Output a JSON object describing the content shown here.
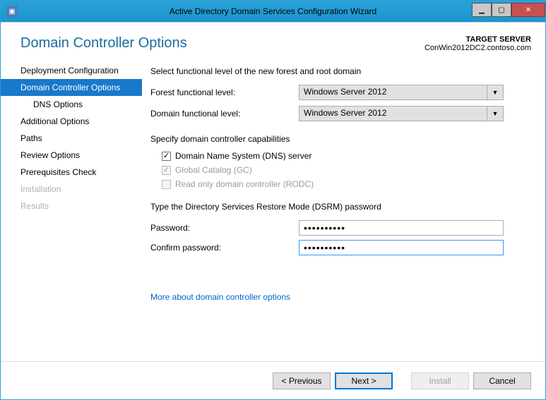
{
  "titlebar": {
    "title": "Active Directory Domain Services Configuration Wizard"
  },
  "header": {
    "page_title": "Domain Controller Options",
    "target_label": "TARGET SERVER",
    "target_value": "ConWin2012DC2.contoso.com"
  },
  "sidebar": {
    "items": [
      {
        "label": "Deployment Configuration",
        "active": false,
        "disabled": false,
        "sub": false
      },
      {
        "label": "Domain Controller Options",
        "active": true,
        "disabled": false,
        "sub": false
      },
      {
        "label": "DNS Options",
        "active": false,
        "disabled": false,
        "sub": true
      },
      {
        "label": "Additional Options",
        "active": false,
        "disabled": false,
        "sub": false
      },
      {
        "label": "Paths",
        "active": false,
        "disabled": false,
        "sub": false
      },
      {
        "label": "Review Options",
        "active": false,
        "disabled": false,
        "sub": false
      },
      {
        "label": "Prerequisites Check",
        "active": false,
        "disabled": false,
        "sub": false
      },
      {
        "label": "Installation",
        "active": false,
        "disabled": true,
        "sub": false
      },
      {
        "label": "Results",
        "active": false,
        "disabled": true,
        "sub": false
      }
    ]
  },
  "content": {
    "functional_intro": "Select functional level of the new forest and root domain",
    "ffl_label": "Forest functional level:",
    "ffl_value": "Windows Server 2012",
    "dfl_label": "Domain functional level:",
    "dfl_value": "Windows Server 2012",
    "caps_intro": "Specify domain controller capabilities",
    "chk_dns_label": "Domain Name System (DNS) server",
    "chk_dns_checked": true,
    "chk_gc_label": "Global Catalog (GC)",
    "chk_gc_checked": true,
    "chk_rodc_label": "Read only domain controller (RODC)",
    "chk_rodc_checked": false,
    "dsrm_intro": "Type the Directory Services Restore Mode (DSRM) password",
    "pw_label": "Password:",
    "pw_value": "••••••••••",
    "cpw_label": "Confirm password:",
    "cpw_value": "••••••••••",
    "more_link": "More about domain controller options"
  },
  "footer": {
    "prev": "< Previous",
    "next": "Next >",
    "install": "Install",
    "cancel": "Cancel"
  }
}
